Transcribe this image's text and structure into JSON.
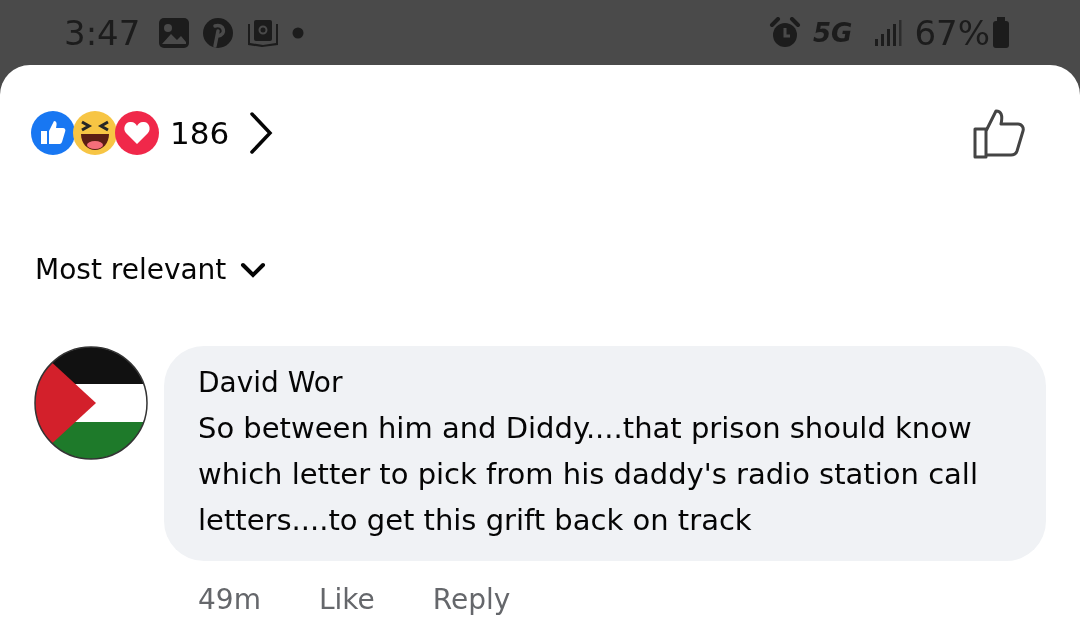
{
  "status_bar": {
    "time": "3:47",
    "network": "5G",
    "battery": "67%"
  },
  "reactions": {
    "count": "186"
  },
  "sort": {
    "label": "Most relevant"
  },
  "comments": [
    {
      "author": "David Wor",
      "text": "So between him and Diddy....that prison should know which letter to pick from his daddy's radio station call letters....to get this grift back on track",
      "time": "49m",
      "actions": [
        "Like",
        "Reply"
      ]
    }
  ]
}
